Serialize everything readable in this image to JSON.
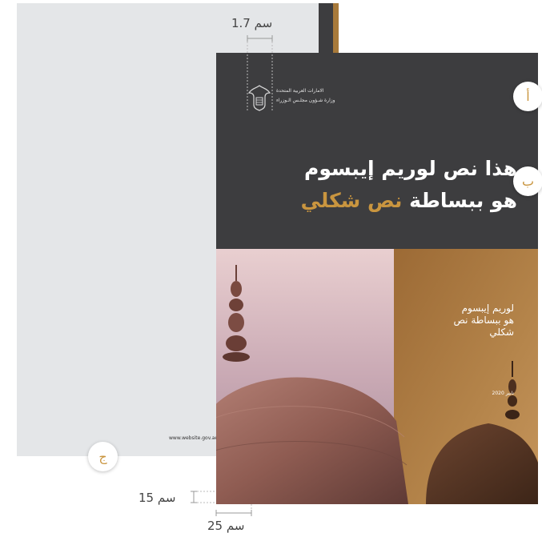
{
  "back_page": {
    "website": "www.website.gov.ae"
  },
  "front_page": {
    "ministry_line_1": "الامارات العربية المتحدة",
    "ministry_line_2": "وزارة شـؤون مجلـس الـوزراء",
    "headline_line_1": "هذا نص لوريم إيبسوم",
    "headline_line_2_part_1": "هو ببساطة ",
    "headline_line_2_part_2": "نص شكلي",
    "panel_line_1": "لوريم إيبسوم",
    "panel_line_2": "هو ببساطة نص",
    "panel_line_3": "شكلي",
    "date": "نابير 2020"
  },
  "markers": {
    "a": "أ",
    "b": "ب",
    "c": "ج"
  },
  "measurements": {
    "top": "1.7 سم",
    "left": "15 سم",
    "bottom": "25 سم"
  },
  "colors": {
    "dark": "#3d3d3f",
    "gold": "#c9953f",
    "back_page": "#e4e6e8"
  },
  "icons": {
    "emblem": "uae-emblem-icon"
  }
}
